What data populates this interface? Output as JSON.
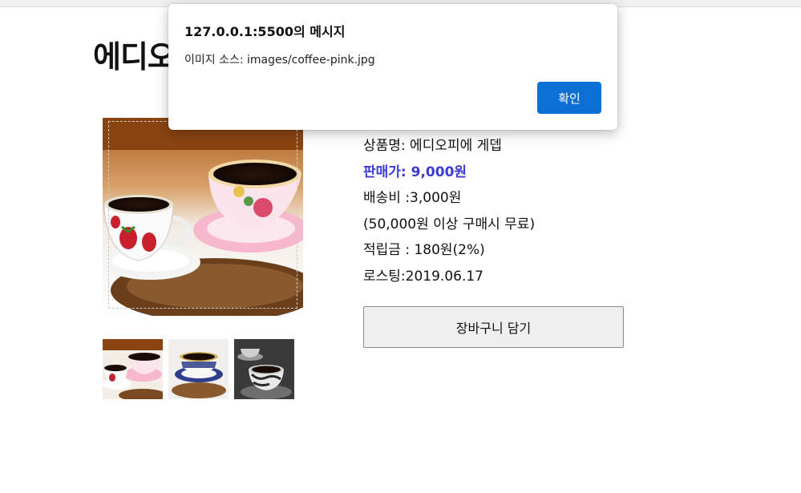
{
  "page": {
    "title": "에디오피에 게뎁"
  },
  "product": {
    "main_image_alt": "images/coffee-pink.jpg",
    "name_row": "상품명: 에디오피에 게뎁",
    "price_row": "판매가: 9,000원",
    "shipping_row": "배송비 :3,000원",
    "free_shipping_row": "(50,000원 이상 구매시 무료)",
    "points_row": "적립금 : 180원(2%)",
    "roasting_row": "로스팅:2019.06.17",
    "cart_button_label": "장바구니 담기",
    "price_color": "#3b3bd6"
  },
  "thumbnails": [
    {
      "name": "coffee-pink-thumb"
    },
    {
      "name": "coffee-blue-thumb"
    },
    {
      "name": "coffee-gray-thumb"
    }
  ],
  "alert": {
    "title": "127.0.0.1:5500의 메시지",
    "message": "이미지 소스: images/coffee-pink.jpg",
    "ok_label": "확인",
    "ok_color": "#0b6fd4"
  }
}
